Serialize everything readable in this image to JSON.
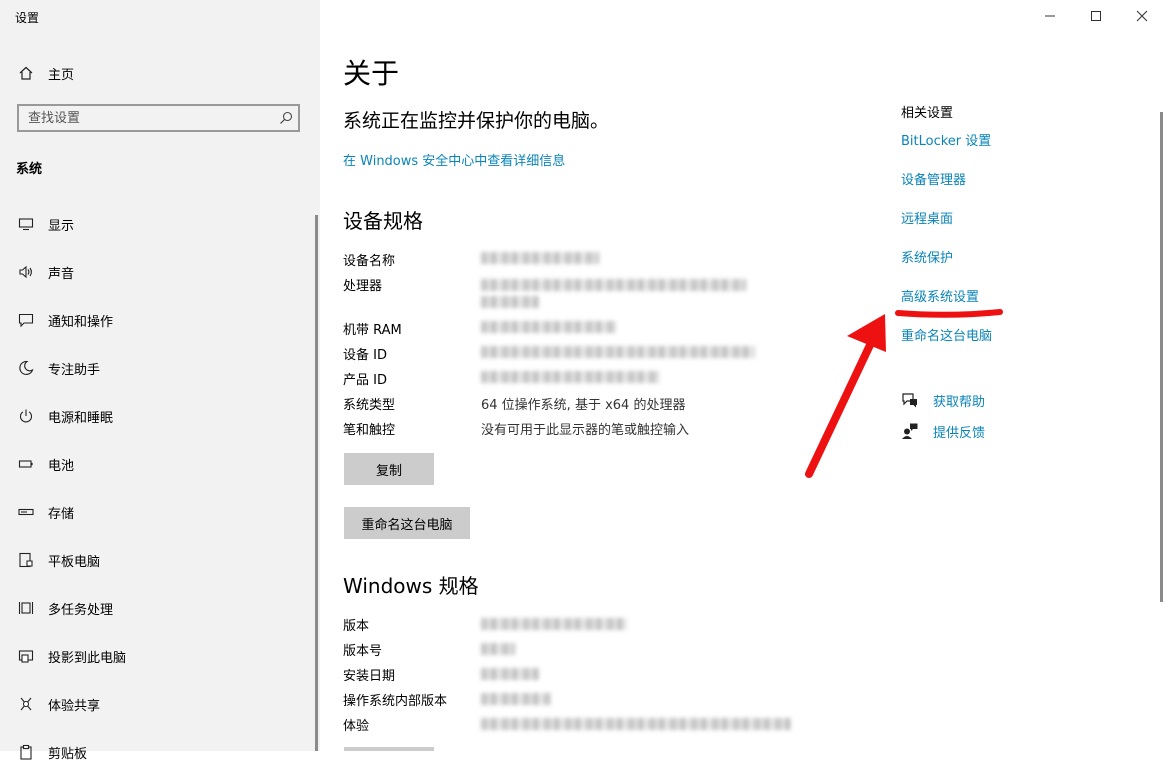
{
  "window": {
    "title": "设置",
    "controls": [
      "minimize-icon",
      "maximize-icon",
      "close-icon"
    ]
  },
  "sidebar": {
    "home": {
      "label": "主页",
      "icon": "home-icon"
    },
    "search": {
      "placeholder": "查找设置",
      "icon": "search-icon"
    },
    "section": "系统",
    "items": [
      {
        "label": "显示",
        "icon": "monitor-icon"
      },
      {
        "label": "声音",
        "icon": "speaker-icon"
      },
      {
        "label": "通知和操作",
        "icon": "notification-icon"
      },
      {
        "label": "专注助手",
        "icon": "moon-icon"
      },
      {
        "label": "电源和睡眠",
        "icon": "power-icon"
      },
      {
        "label": "电池",
        "icon": "battery-icon"
      },
      {
        "label": "存储",
        "icon": "storage-icon"
      },
      {
        "label": "平板电脑",
        "icon": "tablet-icon"
      },
      {
        "label": "多任务处理",
        "icon": "multitask-icon"
      },
      {
        "label": "投影到此电脑",
        "icon": "project-icon"
      },
      {
        "label": "体验共享",
        "icon": "share-icon"
      },
      {
        "label": "剪贴板",
        "icon": "clipboard-icon"
      }
    ]
  },
  "main": {
    "title": "关于",
    "protection_text": "系统正在监控并保护你的电脑。",
    "security_link": "在 Windows 安全中心中查看详细信息",
    "device_specs": {
      "heading": "设备规格",
      "rows": [
        {
          "label": "设备名称",
          "value": ""
        },
        {
          "label": "处理器",
          "value": ""
        },
        {
          "label": "机带 RAM",
          "value": ""
        },
        {
          "label": "设备 ID",
          "value": ""
        },
        {
          "label": "产品 ID",
          "value": ""
        },
        {
          "label": "系统类型",
          "value": "64 位操作系统, 基于 x64 的处理器"
        },
        {
          "label": "笔和触控",
          "value": "没有可用于此显示器的笔或触控输入"
        }
      ],
      "copy_button": "复制",
      "rename_button": "重命名这台电脑"
    },
    "windows_specs": {
      "heading": "Windows 规格",
      "rows": [
        {
          "label": "版本",
          "value": ""
        },
        {
          "label": "版本号",
          "value": ""
        },
        {
          "label": "安装日期",
          "value": ""
        },
        {
          "label": "操作系统内部版本",
          "value": ""
        },
        {
          "label": "体验",
          "value": ""
        }
      ]
    }
  },
  "related": {
    "heading": "相关设置",
    "links": [
      "BitLocker 设置",
      "设备管理器",
      "远程桌面",
      "系统保护",
      "高级系统设置",
      "重命名这台电脑"
    ],
    "help": [
      {
        "label": "获取帮助",
        "icon": "help-chat-icon"
      },
      {
        "label": "提供反馈",
        "icon": "feedback-icon"
      }
    ]
  },
  "annotation": {
    "color": "#ee1111",
    "target": "高级系统设置"
  }
}
